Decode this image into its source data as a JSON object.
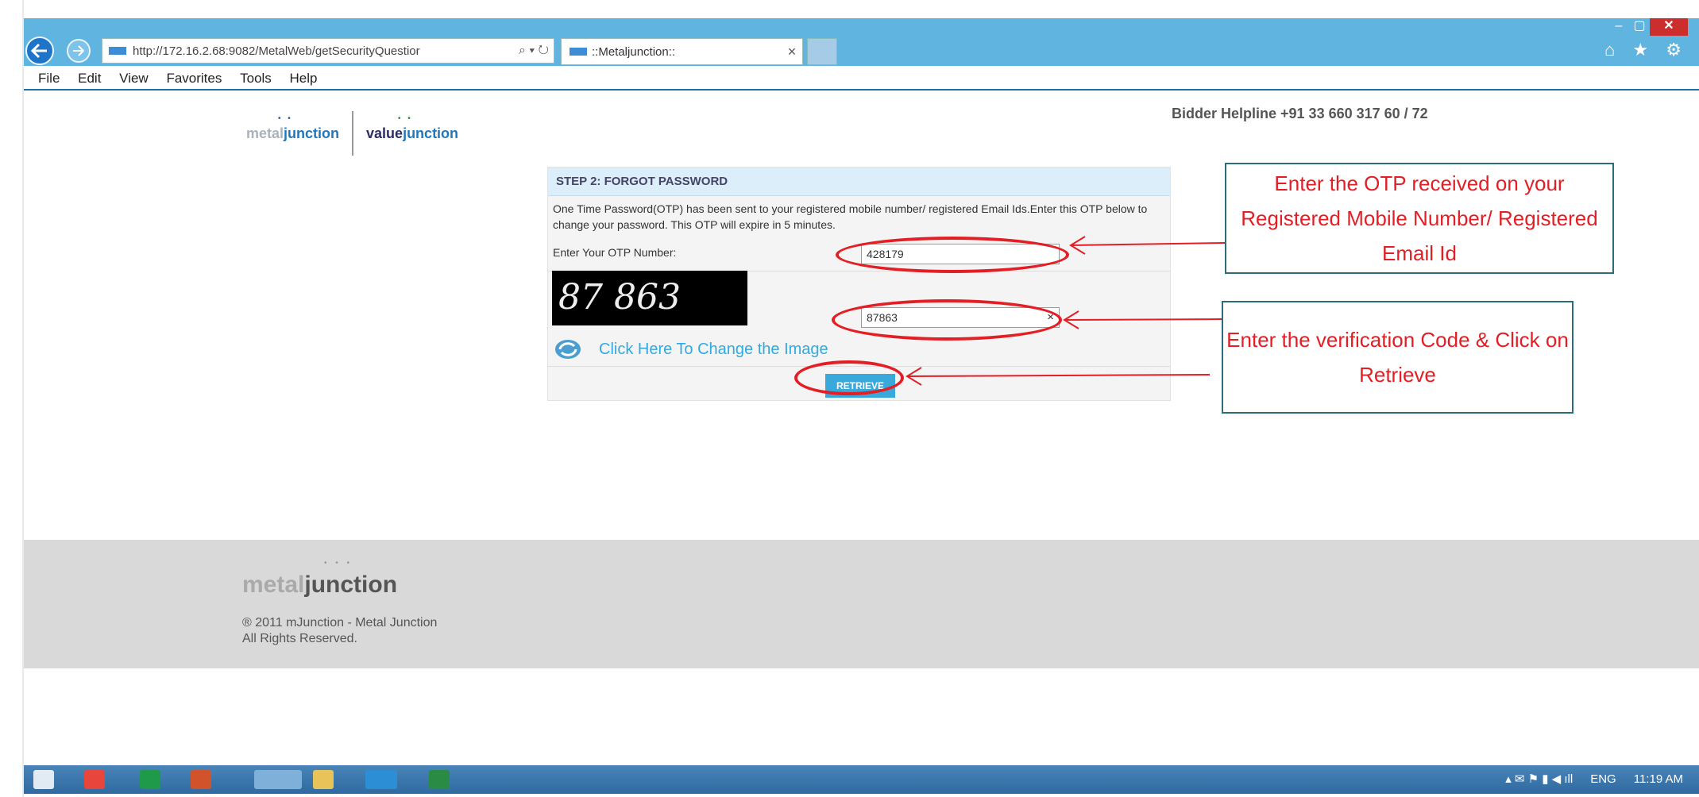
{
  "browser": {
    "address_url": "http://172.16.2.68:9082/MetalWeb/getSecurityQuestior",
    "address_icons": "⌕ ▾ ↻",
    "tab_title": "::Metaljunction::",
    "tab_close": "×",
    "menu": [
      "File",
      "Edit",
      "View",
      "Favorites",
      "Tools",
      "Help"
    ],
    "right_icons": "⌂ ★ ⚙",
    "window_controls": {
      "min": "–",
      "max": "▢",
      "close": "✕"
    }
  },
  "header": {
    "logo_metal_pre": "metal",
    "logo_metal_post": "junction",
    "logo_value_pre": "value",
    "logo_value_post": "junction",
    "helpline": "Bidder Helpline +91 33 660 317 60 / 72"
  },
  "form": {
    "title": "STEP 2: FORGOT PASSWORD",
    "message": "One Time Password(OTP) has been sent to your registered mobile number/ registered Email Ids.Enter this OTP below to change your password. This OTP will expire in 5 minutes.",
    "otp_label": "Enter Your OTP Number:",
    "otp_value": "428179",
    "captcha_text": "87 863",
    "code_value": "87863",
    "clear_label": "×",
    "refresh_link": "Click Here To Change the Image",
    "retrieve_label": "RETRIEVE"
  },
  "annotations": {
    "callout1": "Enter the OTP received on your Registered Mobile Number/ Registered Email Id",
    "callout2": "Enter the verification Code & Click on Retrieve",
    "color": "#e31e24"
  },
  "footer": {
    "logo_pre": "metal",
    "logo_post": "junction",
    "copyright_line1": "® 2011 mJunction - Metal Junction",
    "copyright_line2": "All Rights Reserved."
  },
  "taskbar": {
    "tray_lang": "ENG",
    "tray_time": "11:19 AM"
  }
}
